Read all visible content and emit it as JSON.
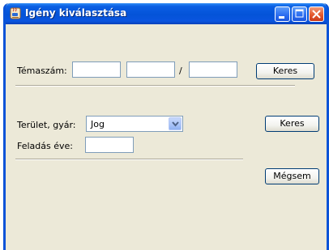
{
  "window": {
    "title": "Igény kiválasztása"
  },
  "form": {
    "temaszam_label": "Témaszám:",
    "slash": "/",
    "temaszam_values": [
      "",
      "",
      ""
    ],
    "search1_label": "Keres",
    "terulet_label": "Terület, gyár:",
    "terulet_value": "Jog",
    "search2_label": "Keres",
    "feladas_label": "Feladás éve:",
    "feladas_value": "",
    "cancel_label": "Mégsem"
  },
  "icons": {
    "app": "java-cup-icon",
    "minimize": "minimize-icon",
    "maximize": "maximize-icon",
    "close": "close-icon",
    "dropdown": "chevron-down-icon"
  },
  "colors": {
    "titlebar": "#0453d8",
    "window_bg": "#ece9d8",
    "close_button": "#e5592e"
  }
}
